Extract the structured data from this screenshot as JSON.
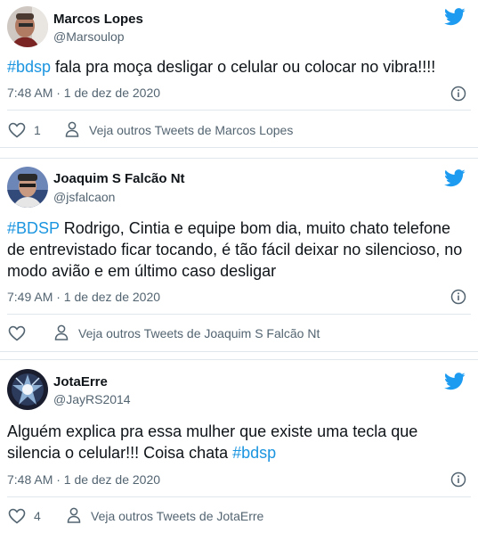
{
  "colors": {
    "twitter_blue": "#1d9bf0",
    "hashtag": "#1b95e0",
    "text": "#0f1419",
    "secondary": "#536471",
    "divider": "#e1e8ed"
  },
  "tweets": [
    {
      "author_name": "Marcos Lopes",
      "author_handle": "@Marsoulop",
      "text_parts": [
        {
          "type": "hashtag",
          "value": "#bdsp"
        },
        {
          "type": "text",
          "value": " fala pra moça desligar o celular ou colocar no vibra!!!!"
        }
      ],
      "timestamp": "7:48 AM · 1 de dez de 2020",
      "like_count": "1",
      "more_tweets_label": "Veja outros Tweets de Marcos Lopes",
      "icons": [
        "twitter-bird-icon",
        "info-icon",
        "heart-icon",
        "person-icon"
      ]
    },
    {
      "author_name": "Joaquim S Falcão Nt",
      "author_handle": "@jsfalcaon",
      "text_parts": [
        {
          "type": "hashtag",
          "value": "#BDSP"
        },
        {
          "type": "text",
          "value": "  Rodrigo, Cintia e equipe bom dia, muito chato telefone de entrevistado ficar tocando, é tão fácil deixar no silencioso, no modo avião e em último caso desligar"
        }
      ],
      "timestamp": "7:49 AM · 1 de dez de 2020",
      "like_count": "",
      "more_tweets_label": "Veja outros Tweets de Joaquim S Falcão Nt",
      "icons": [
        "twitter-bird-icon",
        "info-icon",
        "heart-icon",
        "person-icon"
      ]
    },
    {
      "author_name": "JotaErre",
      "author_handle": "@JayRS2014",
      "text_parts": [
        {
          "type": "text",
          "value": "Alguém explica pra essa mulher que existe uma tecla que silencia o celular!!! Coisa chata  "
        },
        {
          "type": "hashtag",
          "value": "#bdsp"
        }
      ],
      "timestamp": "7:48 AM · 1 de dez de 2020",
      "like_count": "4",
      "more_tweets_label": "Veja outros Tweets de JotaErre",
      "icons": [
        "twitter-bird-icon",
        "info-icon",
        "heart-icon",
        "person-icon"
      ]
    }
  ]
}
